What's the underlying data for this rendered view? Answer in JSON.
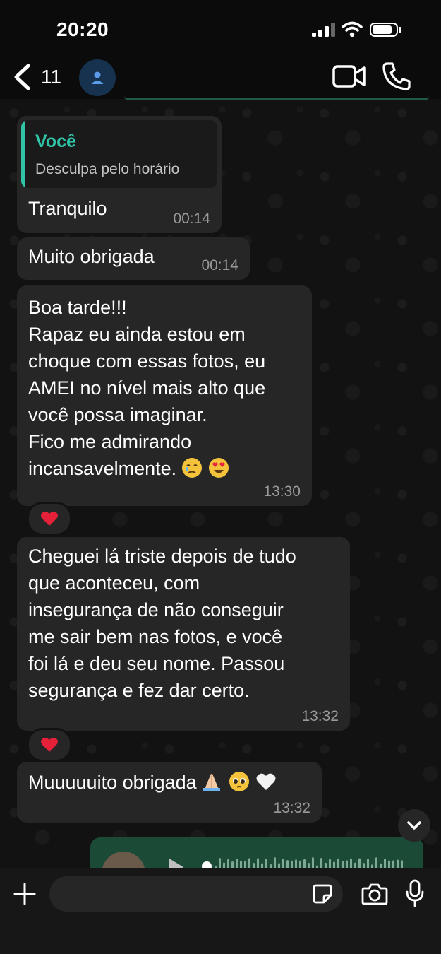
{
  "status_bar": {
    "time": "20:20",
    "battery_level": 0.85
  },
  "header": {
    "back_count": "11",
    "contact_name": ""
  },
  "messages": [
    {
      "quote": {
        "author": "Você",
        "text": "Desculpa pelo horário"
      },
      "text": "Tranquilo",
      "time": "00:14"
    },
    {
      "text": "Muito obrigada",
      "time": "00:14"
    },
    {
      "text": "Boa tarde!!!\nRapaz eu ainda estou em\nchoque com essas fotos, eu\nAMEI no nível mais alto que\nvocê possa imaginar.\n Fico me admirando\nincansavelmente.",
      "time": "13:30",
      "reaction": "red-heart"
    },
    {
      "text": "Cheguei lá triste depois de tudo\nque aconteceu, com\ninsegurança de não conseguir\nme sair bem nas fotos, e você\nfoi lá e deu seu nome. Passou\nsegurança e fez dar certo.",
      "time": "13:32",
      "reaction": "red-heart"
    },
    {
      "text": "Muuuuuito obrigada",
      "time": "13:32"
    }
  ],
  "icons": {
    "message_3_emojis": [
      "face-holding-back-tears",
      "heart-eyes"
    ],
    "message_5_emojis": [
      "folded-hands",
      "pleading-face",
      "white-heart"
    ]
  },
  "colors": {
    "accent": "#2ec4a5",
    "bubble": "#262626",
    "outgoing": "#1b4a36",
    "time": "#9a9a9a"
  },
  "composer": {
    "placeholder": ""
  }
}
